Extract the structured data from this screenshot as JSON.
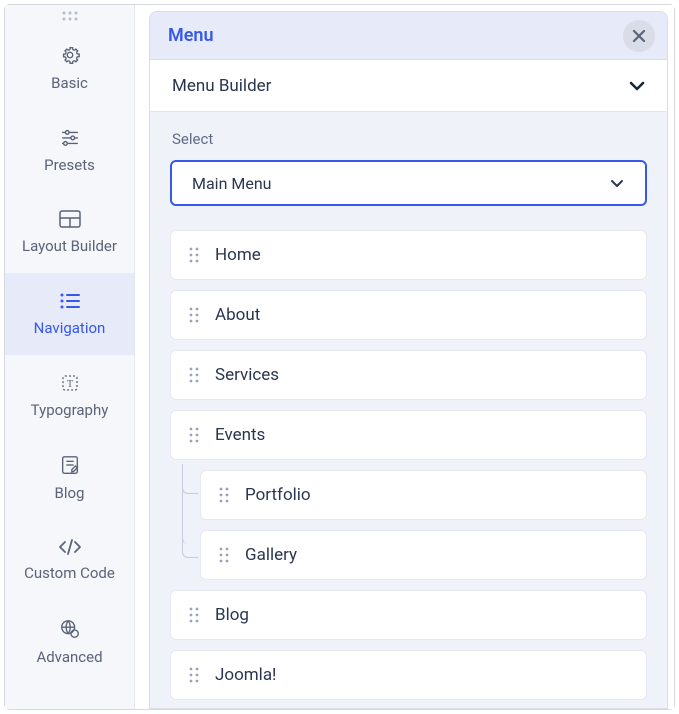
{
  "sidebar": {
    "items": [
      {
        "label": "Basic",
        "icon": "gear-icon",
        "active": false
      },
      {
        "label": "Presets",
        "icon": "sliders-icon",
        "active": false
      },
      {
        "label": "Layout Builder",
        "icon": "layout-icon",
        "active": false
      },
      {
        "label": "Navigation",
        "icon": "list-icon",
        "active": true
      },
      {
        "label": "Typography",
        "icon": "type-icon",
        "active": false
      },
      {
        "label": "Blog",
        "icon": "blog-icon",
        "active": false
      },
      {
        "label": "Custom Code",
        "icon": "code-icon",
        "active": false
      },
      {
        "label": "Advanced",
        "icon": "globe-icon",
        "active": false
      }
    ]
  },
  "panel": {
    "title": "Menu",
    "subheader": "Menu Builder",
    "select_label": "Select",
    "select_value": "Main Menu"
  },
  "menu_items": [
    {
      "label": "Home",
      "children": []
    },
    {
      "label": "About",
      "children": []
    },
    {
      "label": "Services",
      "children": []
    },
    {
      "label": "Events",
      "children": [
        {
          "label": "Portfolio"
        },
        {
          "label": "Gallery"
        }
      ]
    },
    {
      "label": "Blog",
      "children": []
    },
    {
      "label": "Joomla!",
      "children": []
    }
  ]
}
